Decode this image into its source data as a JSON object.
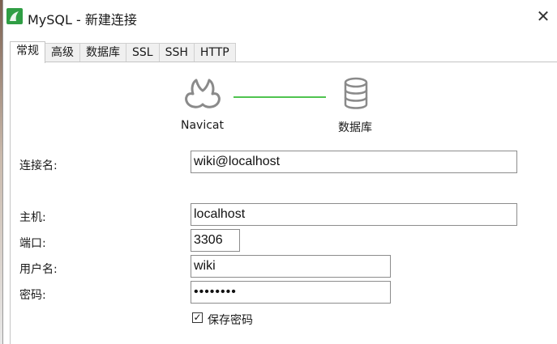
{
  "window": {
    "title": "MySQL - 新建连接",
    "close_glyph": "✕"
  },
  "tabs": [
    {
      "label": "常规",
      "active": true
    },
    {
      "label": "高级",
      "active": false
    },
    {
      "label": "数据库",
      "active": false
    },
    {
      "label": "SSL",
      "active": false
    },
    {
      "label": "SSH",
      "active": false
    },
    {
      "label": "HTTP",
      "active": false
    }
  ],
  "diagram": {
    "left_label": "Navicat",
    "right_label": "数据库",
    "link_color": "#4fc34f"
  },
  "form": {
    "connection_name_label": "连接名:",
    "connection_name_value": "wiki@localhost",
    "host_label": "主机:",
    "host_value": "localhost",
    "port_label": "端口:",
    "port_value": "3306",
    "user_label": "用户名:",
    "user_value": "wiki",
    "password_label": "密码:",
    "password_value": "••••••••",
    "save_password_label": "保存密码",
    "save_password_checked": true,
    "checkbox_glyph": "✓"
  },
  "colors": {
    "app_icon": "#2f9e44"
  }
}
